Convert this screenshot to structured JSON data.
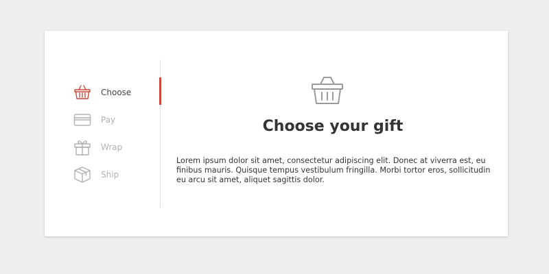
{
  "colors": {
    "accent": "#d0473a",
    "active_text": "#444444",
    "inactive_text": "#b0b0b0",
    "icon_gray": "#999999",
    "background": "#eeeeee",
    "card": "#ffffff"
  },
  "steps": [
    {
      "label": "Choose",
      "icon": "basket-icon",
      "active": true
    },
    {
      "label": "Pay",
      "icon": "credit-card-icon",
      "active": false
    },
    {
      "label": "Wrap",
      "icon": "gift-icon",
      "active": false
    },
    {
      "label": "Ship",
      "icon": "box-icon",
      "active": false
    }
  ],
  "content": {
    "icon": "basket-icon",
    "title": "Choose your gift",
    "description": "Lorem ipsum dolor sit amet, consectetur adipiscing elit. Donec at viverra est, eu finibus mauris. Quisque tempus vestibulum fringilla. Morbi tortor eros, sollicitudin eu arcu sit amet, aliquet sagittis dolor."
  }
}
